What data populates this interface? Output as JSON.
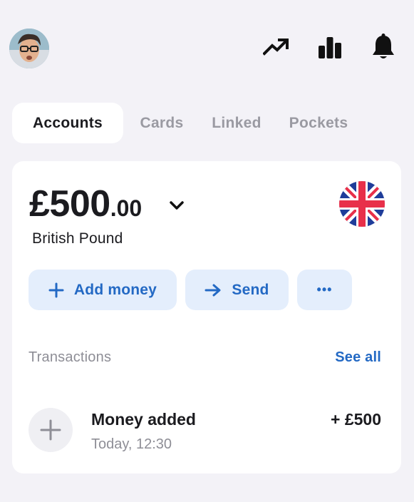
{
  "header": {
    "avatar_icon": "user-avatar",
    "icons": [
      "trending-up-icon",
      "bar-chart-icon",
      "bell-icon"
    ]
  },
  "tabs": [
    {
      "label": "Accounts",
      "active": true
    },
    {
      "label": "Cards",
      "active": false
    },
    {
      "label": "Linked",
      "active": false
    },
    {
      "label": "Pockets",
      "active": false
    }
  ],
  "account": {
    "balance_whole": "£500",
    "balance_decimal": ".00",
    "currency_name": "British Pound",
    "flag_icon": "uk-flag-icon"
  },
  "actions": {
    "add_money": "Add money",
    "send": "Send",
    "more": "•••"
  },
  "transactions": {
    "title": "Transactions",
    "see_all": "See all",
    "items": [
      {
        "name": "Money added",
        "time": "Today, 12:30",
        "amount": "+ £500",
        "icon": "plus-icon"
      }
    ]
  },
  "colors": {
    "background": "#f3f2f7",
    "card": "#ffffff",
    "accent": "#2369c4",
    "accent_bg": "#e4eefc",
    "muted_text": "#8e8e96"
  }
}
